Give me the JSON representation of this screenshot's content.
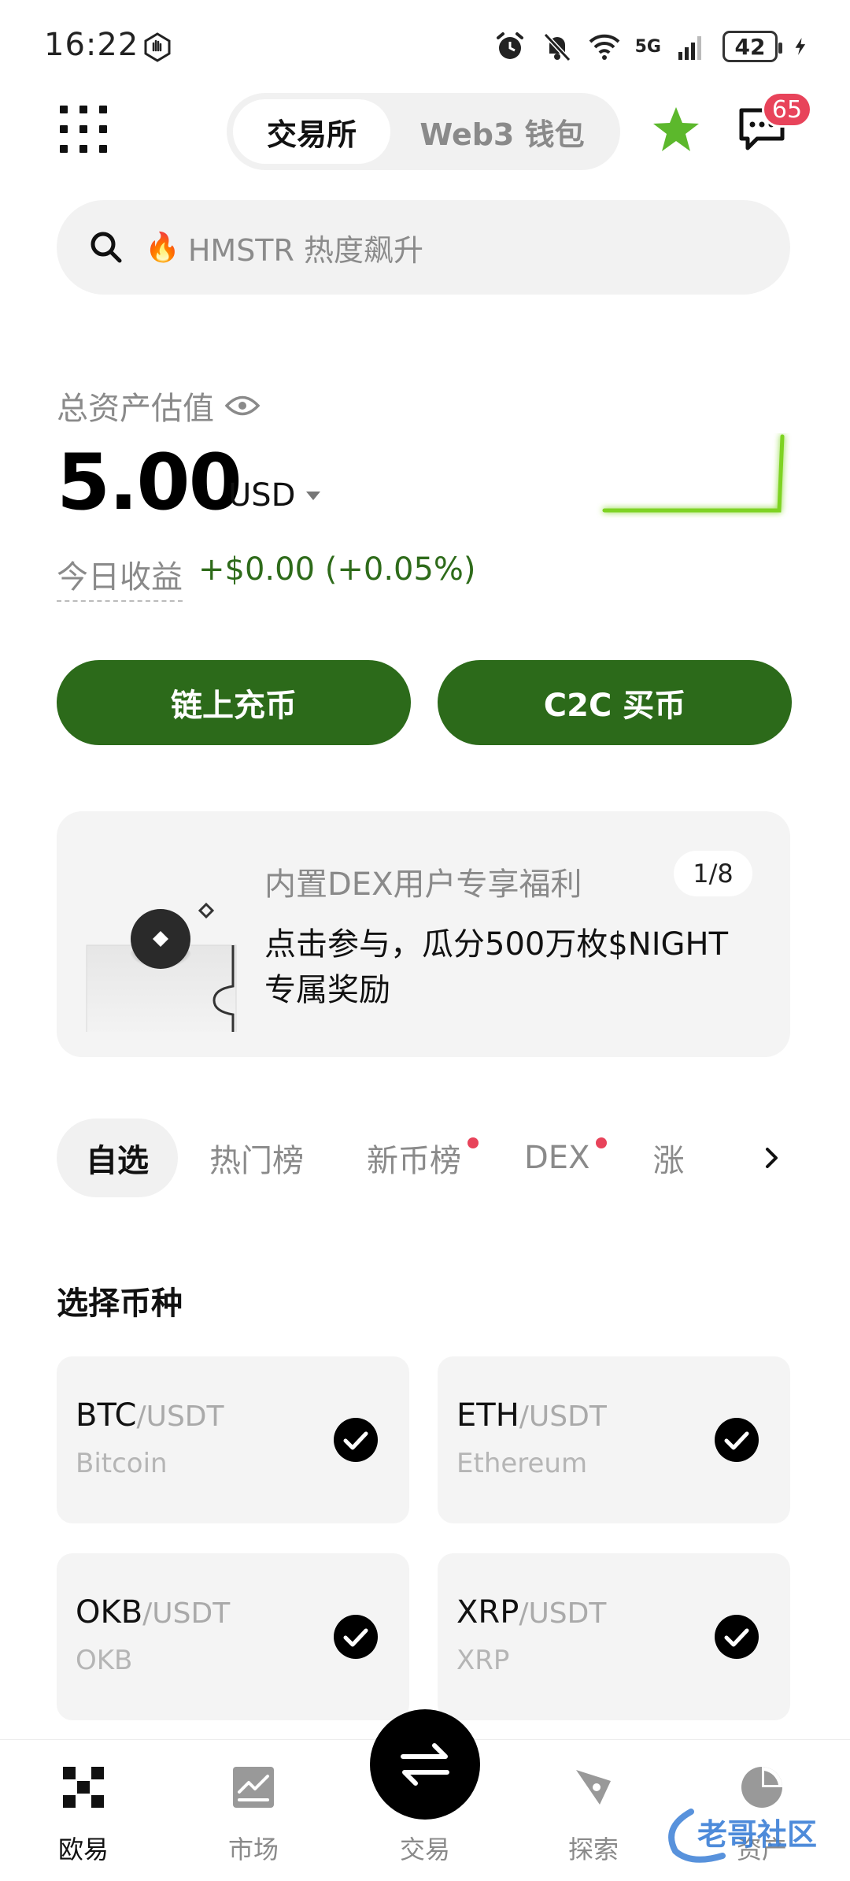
{
  "status_bar": {
    "time": "16:22",
    "network": "5G",
    "battery": "42"
  },
  "header": {
    "tabs": [
      {
        "label": "交易所",
        "active": true
      },
      {
        "label": "Web3 钱包",
        "active": false
      }
    ],
    "message_badge": "65",
    "icons": [
      "grid-menu-icon",
      "star-icon",
      "message-icon"
    ]
  },
  "search": {
    "placeholder": "HMSTR 热度飙升",
    "icons": [
      "search-icon",
      "fire-icon"
    ]
  },
  "assets": {
    "label": "总资产估值",
    "value": "5.00",
    "currency": "USD",
    "pnl_label": "今日收益",
    "pnl_value": "+$0.00 (+0.05%)"
  },
  "actions": {
    "deposit": "链上充币",
    "c2c": "C2C 买币"
  },
  "promo": {
    "title": "内置DEX用户专享福利",
    "pager": "1/8",
    "description": "点击参与，瓜分500万枚$NIGHT专属奖励"
  },
  "tabs": [
    {
      "label": "自选",
      "active": true,
      "dot": false
    },
    {
      "label": "热门榜",
      "active": false,
      "dot": false
    },
    {
      "label": "新币榜",
      "active": false,
      "dot": true
    },
    {
      "label": "DEX",
      "active": false,
      "dot": true
    },
    {
      "label": "涨",
      "active": false,
      "dot": false
    }
  ],
  "section": {
    "title": "选择币种"
  },
  "coins": [
    {
      "base": "BTC",
      "quote": "/USDT",
      "name": "Bitcoin",
      "selected": true
    },
    {
      "base": "ETH",
      "quote": "/USDT",
      "name": "Ethereum",
      "selected": true
    },
    {
      "base": "OKB",
      "quote": "/USDT",
      "name": "OKB",
      "selected": true
    },
    {
      "base": "XRP",
      "quote": "/USDT",
      "name": "XRP",
      "selected": true
    }
  ],
  "bottom_nav": {
    "items": [
      {
        "label": "欧易",
        "icon": "okx-logo-icon",
        "active": true
      },
      {
        "label": "市场",
        "icon": "market-chart-icon",
        "active": false
      },
      {
        "label": "交易",
        "icon": "trade-swap-icon",
        "active": false
      },
      {
        "label": "探索",
        "icon": "explore-compass-icon",
        "active": false
      },
      {
        "label": "资产",
        "icon": "assets-pie-icon",
        "active": false
      }
    ]
  },
  "watermark": "老哥社区",
  "colors": {
    "primary_green": "#2c6a1a",
    "gain_green": "#2e6b1a",
    "sparkline": "#7ed321",
    "badge_red": "#e8435a",
    "card_bg": "#f4f4f4"
  }
}
